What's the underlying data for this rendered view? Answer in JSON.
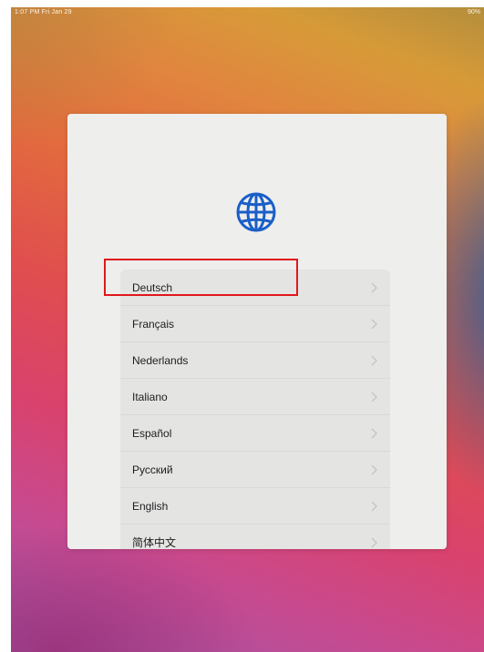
{
  "status_bar": {
    "time_date": "1:07 PM  Fri Jan 29",
    "battery": "90%"
  },
  "icon": "globe-icon",
  "language_list": {
    "items": [
      {
        "label": "Deutsch"
      },
      {
        "label": "Français"
      },
      {
        "label": "Nederlands"
      },
      {
        "label": "Italiano"
      },
      {
        "label": "Español"
      },
      {
        "label": "Русский"
      },
      {
        "label": "English"
      },
      {
        "label": "简体中文"
      }
    ]
  },
  "colors": {
    "accent_blue": "#1a5fc8",
    "highlight_red": "#e0181b",
    "card_bg": "#eeeeec",
    "list_bg": "#e4e4e2"
  }
}
